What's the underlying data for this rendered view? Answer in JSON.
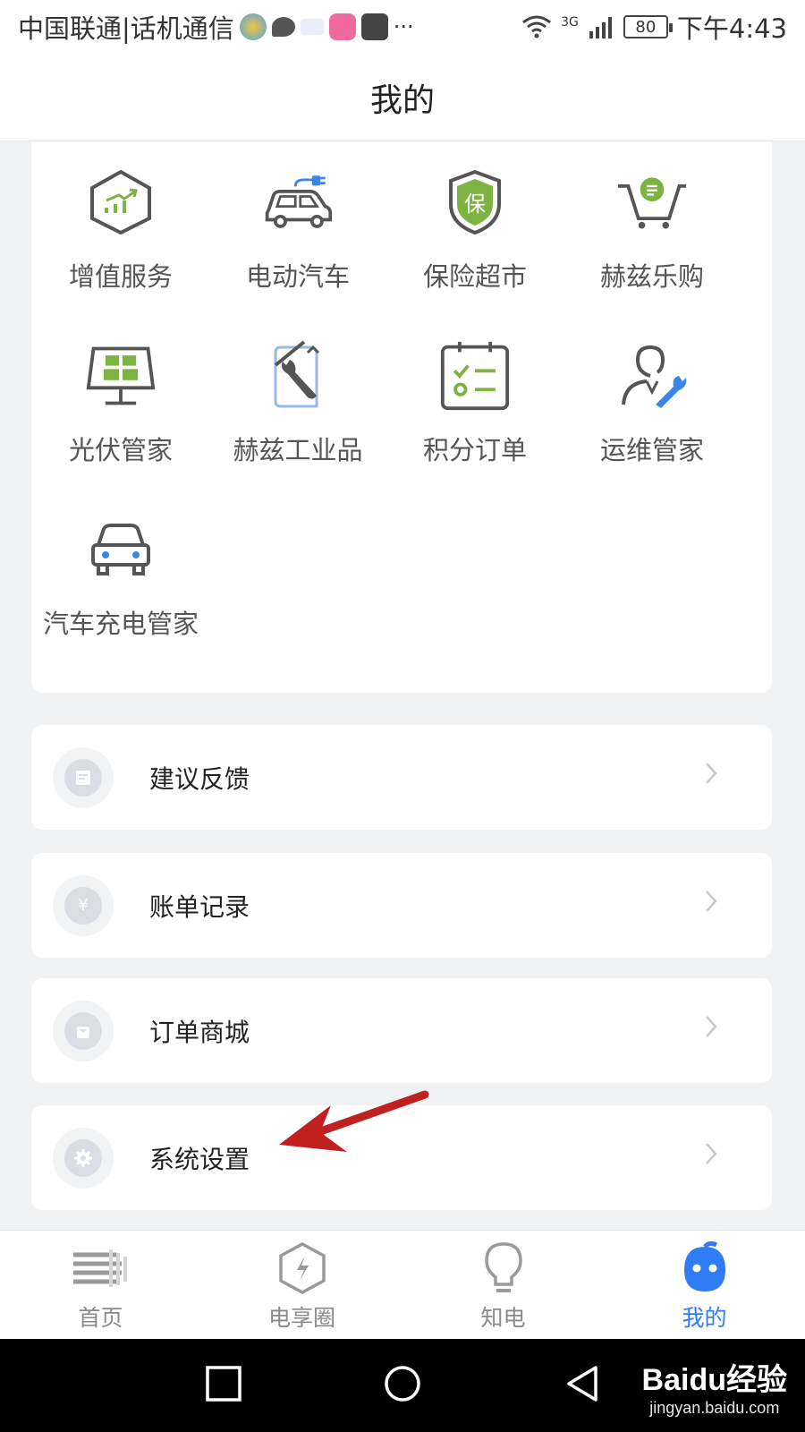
{
  "status_bar": {
    "carrier": "中国联通|话机通信",
    "dots": "···",
    "network": "3G",
    "battery": "80",
    "time": "下午4:43"
  },
  "header": {
    "title": "我的"
  },
  "grid": {
    "items": [
      {
        "label": "增值服务",
        "icon": "value-added-hexagon-icon"
      },
      {
        "label": "电动汽车",
        "icon": "electric-car-icon"
      },
      {
        "label": "保险超市",
        "icon": "insurance-shield-icon"
      },
      {
        "label": "赫兹乐购",
        "icon": "shopping-cart-icon"
      },
      {
        "label": "光伏管家",
        "icon": "solar-panel-icon"
      },
      {
        "label": "赫兹工业品",
        "icon": "industrial-tools-icon"
      },
      {
        "label": "积分订单",
        "icon": "points-order-checklist-icon"
      },
      {
        "label": "运维管家",
        "icon": "maintenance-person-icon"
      },
      {
        "label": "汽车充电管家",
        "icon": "car-charging-icon"
      }
    ],
    "insurance_char": "保"
  },
  "menu": {
    "items": [
      {
        "label": "建议反馈",
        "icon": "feedback-icon"
      },
      {
        "label": "账单记录",
        "icon": "bill-record-icon",
        "glyph": "¥"
      },
      {
        "label": "订单商城",
        "icon": "order-mall-icon"
      },
      {
        "label": "系统设置",
        "icon": "settings-gear-icon"
      }
    ]
  },
  "tabs": {
    "items": [
      {
        "label": "首页",
        "icon": "home-icon"
      },
      {
        "label": "电享圈",
        "icon": "power-circle-icon"
      },
      {
        "label": "知电",
        "icon": "lightbulb-icon"
      },
      {
        "label": "我的",
        "icon": "profile-icon",
        "active": true
      }
    ]
  },
  "watermark": {
    "main": "Baidu经验",
    "sub": "jingyan.baidu.com"
  },
  "colors": {
    "accent_blue": "#2f7cf6",
    "icon_green": "#7cb342",
    "icon_gray": "#555555",
    "arrow_red": "#c0201e"
  }
}
